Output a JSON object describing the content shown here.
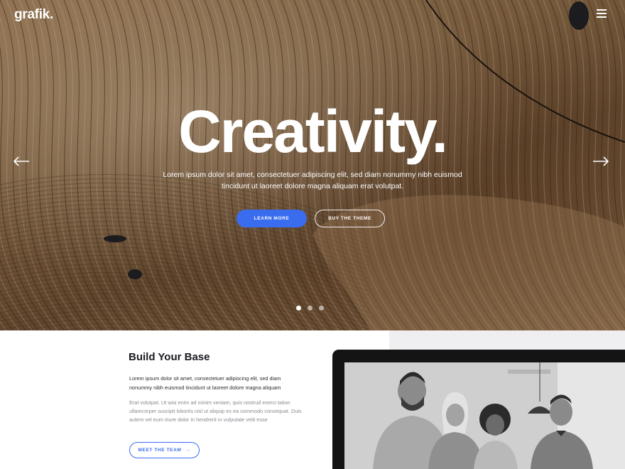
{
  "brand": {
    "logo": "grafik."
  },
  "hero": {
    "headline": "Creativity.",
    "subtext": "Lorem ipsum dolor sit amet, consectetuer adipiscing elit, sed diam nonummy nibh euismod tincidunt ut laoreet dolore magna aliquam erat volutpat.",
    "primary_button": "LEARN MORE",
    "secondary_button": "BUY THE THEME",
    "slide_count": 3,
    "active_slide": 1
  },
  "section": {
    "title": "Build Your Base",
    "intro": "Lorem ipsum dolor sit amet, consectetuer adipiscing elit, sed diam nonummy nibh euismod tincidunt ut laoreet dolore magna aliquam",
    "body": "Erat volutpat. Ut wisi enim ad minim veniam, quis nostrud exerci tation ullamcorper suscipit lobortis nisl ut aliquip ex ea commodo consequat. Duis autem vel eum iriure dolor in hendrerit in vulputate velit esse",
    "button": "MEET THE TEAM",
    "button_arrow": "→"
  },
  "icons": [
    "menu-icon",
    "arrow-left-icon",
    "arrow-right-icon",
    "arrow-right-small-icon"
  ],
  "colors": {
    "accent": "#3a6cf0",
    "dark": "#1b1b22",
    "muted": "#8a8a93",
    "panel": "#efeff1"
  }
}
